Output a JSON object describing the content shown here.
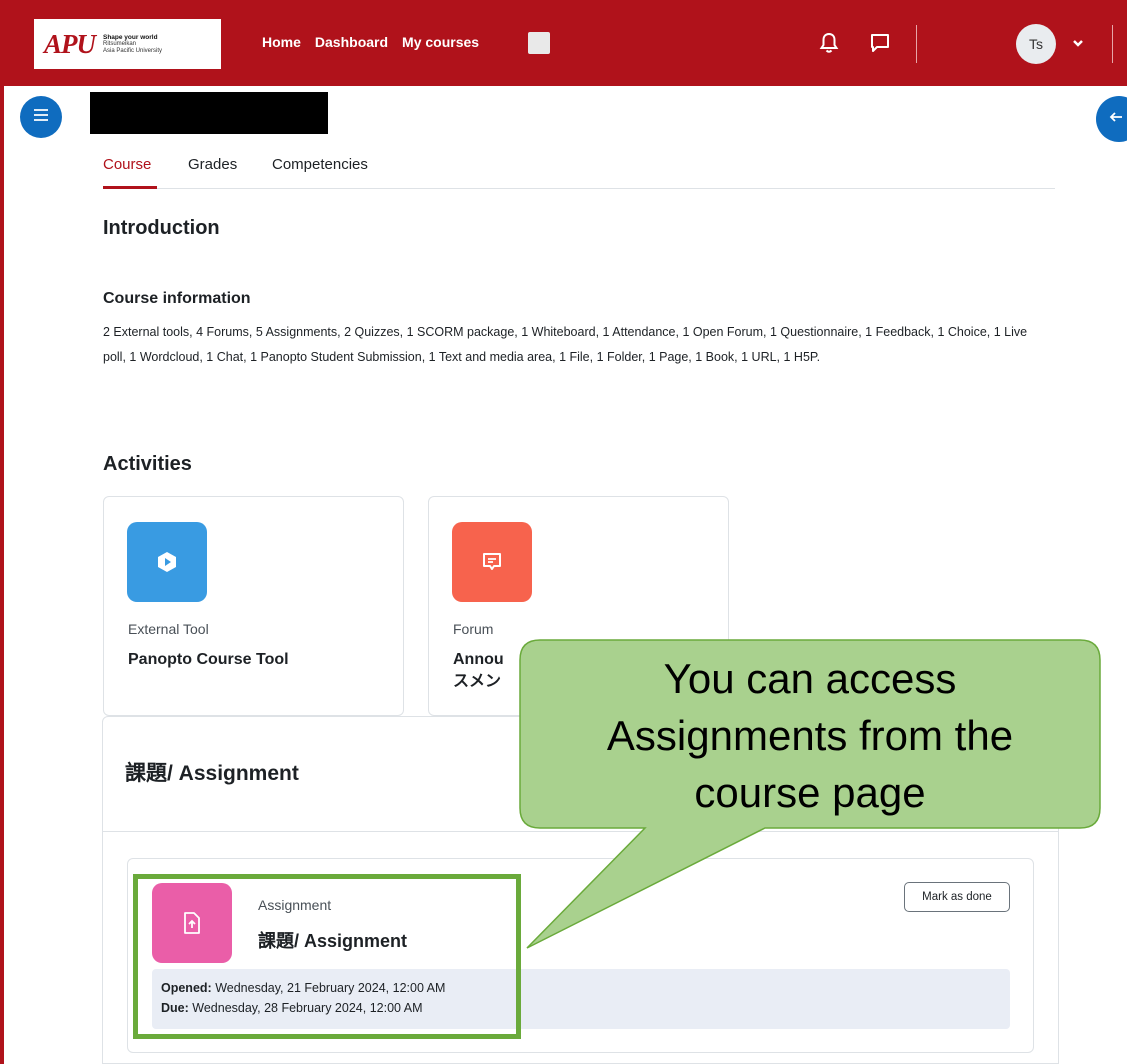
{
  "navbar": {
    "logo": {
      "mark": "APU",
      "tagline": "Shape your world",
      "line1": "Ritsumeikan",
      "line2": "Asia Pacific University"
    },
    "links": [
      "Home",
      "Dashboard",
      "My courses"
    ],
    "user_initials": "Ts",
    "colors": {
      "brand": "#b0121b"
    }
  },
  "tabs": [
    "Course",
    "Grades",
    "Competencies"
  ],
  "active_tab": "Course",
  "introduction": {
    "heading": "Introduction",
    "course_info_heading": "Course information",
    "course_info_text": "2 External tools, 4 Forums, 5 Assignments, 2 Quizzes, 1 SCORM package, 1 Whiteboard, 1 Attendance, 1 Open Forum, 1 Questionnaire, 1 Feedback, 1 Choice, 1 Live poll, 1 Wordcloud, 1 Chat, 1 Panopto Student Submission, 1 Text and media area, 1 File, 1 Folder, 1 Page, 1 Book, 1 URL, 1 H5P."
  },
  "activities": {
    "heading": "Activities",
    "cards": [
      {
        "type": "External Tool",
        "name": "Panopto Course Tool",
        "icon": "external-tool-icon",
        "color": "#399be2"
      },
      {
        "type": "Forum",
        "name": "Annou",
        "name_line2": "スメン",
        "icon": "forum-icon",
        "color": "#f7634d"
      }
    ]
  },
  "section": {
    "title": "課題/ Assignment",
    "assignment": {
      "type": "Assignment",
      "name": "課題/ Assignment",
      "mark_done_label": "Mark as done",
      "opened_label": "Opened:",
      "opened_value": "Wednesday, 21 February 2024, 12:00 AM",
      "due_label": "Due:",
      "due_value": "Wednesday, 28 February 2024, 12:00 AM",
      "icon": "assignment-icon",
      "color": "#ea5ea8"
    }
  },
  "callout": {
    "line1": "You can access",
    "line2": "Assignments from the",
    "line3": "course page",
    "fill": "#a9d18e",
    "stroke": "#6aaa3b"
  }
}
